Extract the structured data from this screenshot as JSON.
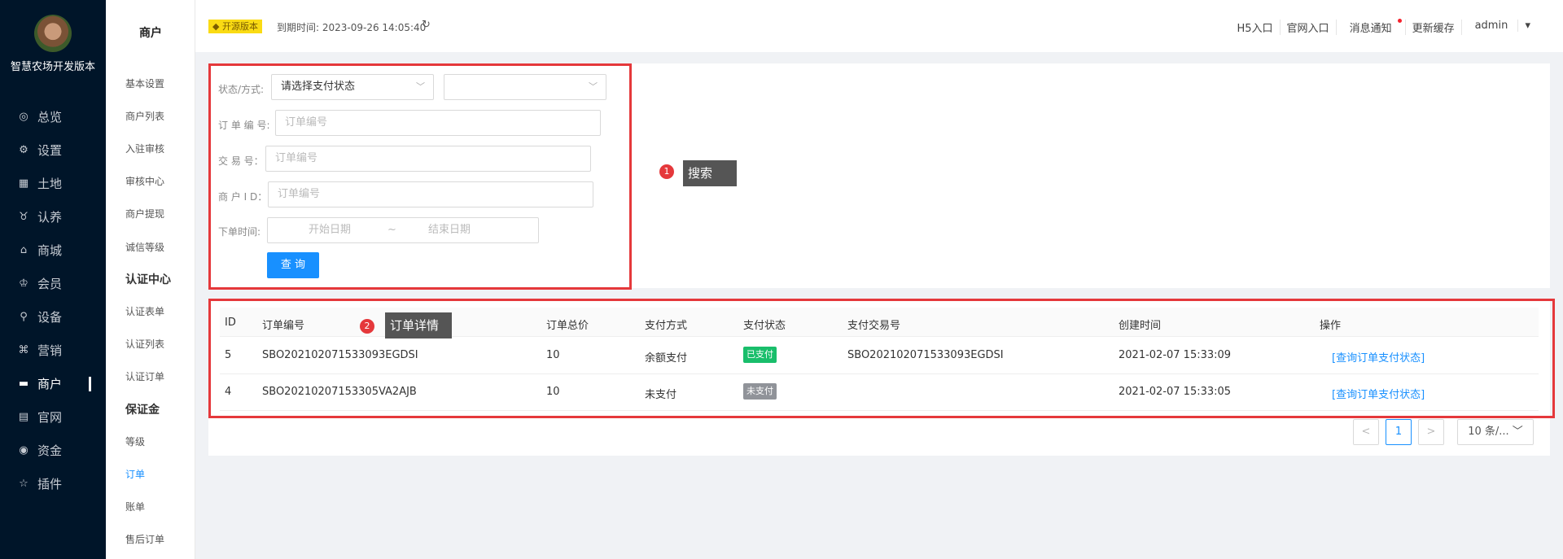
{
  "sidebar": {
    "brand": "智慧农场开发版本",
    "items": [
      {
        "label": "总览",
        "icon": "dashboard-icon",
        "glyph": "◎"
      },
      {
        "label": "设置",
        "icon": "gear-icon",
        "glyph": "⚙"
      },
      {
        "label": "土地",
        "icon": "grid-icon",
        "glyph": "▦"
      },
      {
        "label": "认养",
        "icon": "adopt-icon",
        "glyph": "♉"
      },
      {
        "label": "商城",
        "icon": "store-icon",
        "glyph": "⌂"
      },
      {
        "label": "会员",
        "icon": "member-icon",
        "glyph": "♔"
      },
      {
        "label": "设备",
        "icon": "device-icon",
        "glyph": "⚲"
      },
      {
        "label": "营销",
        "icon": "marketing-icon",
        "glyph": "⌘"
      },
      {
        "label": "商户",
        "icon": "merchant-icon",
        "glyph": "▬"
      },
      {
        "label": "官网",
        "icon": "website-icon",
        "glyph": "▤"
      },
      {
        "label": "资金",
        "icon": "funds-icon",
        "glyph": "◉"
      },
      {
        "label": "插件",
        "icon": "plugin-icon",
        "glyph": "☆"
      }
    ]
  },
  "subnav": {
    "title": "商户",
    "items": [
      "基本设置",
      "商户列表",
      "入驻审核",
      "审核中心",
      "商户提现",
      "诚信等级"
    ],
    "group_cert": "认证中心",
    "cert_items": [
      "认证表单",
      "认证列表",
      "认证订单"
    ],
    "group_deposit": "保证金",
    "deposit_items": [
      "等级",
      "订单",
      "账单",
      "售后订单"
    ]
  },
  "topbar": {
    "badge": "开源版本",
    "expire": "到期时间: 2023-09-26 14:05:40",
    "links": [
      "H5入口",
      "官网入口",
      "消息通知",
      "更新缓存",
      "admin"
    ]
  },
  "search": {
    "status_label": "状态/方式:",
    "status_value": "请选择支付状态",
    "order_label": "订 单 编 号:",
    "order_placeholder": "订单编号",
    "trade_label": "交 易 号：",
    "trade_placeholder": "订单编号",
    "merchant_label": "商 户 I D：",
    "merchant_placeholder": "订单编号",
    "time_label": "下单时间:",
    "start_placeholder": "开始日期",
    "sep": "~",
    "end_placeholder": "结束日期",
    "button": "查 询"
  },
  "annotations": {
    "one_num": "1",
    "one_label": "搜索",
    "two_num": "2",
    "two_label": "订单详情"
  },
  "table": {
    "headers": [
      "ID",
      "订单编号",
      "订单总价",
      "支付方式",
      "支付状态",
      "支付交易号",
      "创建时间",
      "操作"
    ],
    "rows": [
      {
        "id": "5",
        "order_no": "SBO202102071533093EGDSI",
        "total": "10",
        "method": "余额支付",
        "status": "已支付",
        "trade_no": "SBO202102071533093EGDSI",
        "created": "2021-02-07 15:33:09",
        "action": "[查询订单支付状态]"
      },
      {
        "id": "4",
        "order_no": "SBO20210207153305VA2AJB",
        "total": "10",
        "method": "未支付",
        "status": "未支付",
        "trade_no": "",
        "created": "2021-02-07 15:33:05",
        "action": "[查询订单支付状态]"
      }
    ],
    "status_colors": {
      "paid": "#19be6b",
      "unpaid": "#909399"
    }
  },
  "pagination": {
    "prev": "<",
    "current": "1",
    "next": ">",
    "page_size": "10 条/..."
  }
}
